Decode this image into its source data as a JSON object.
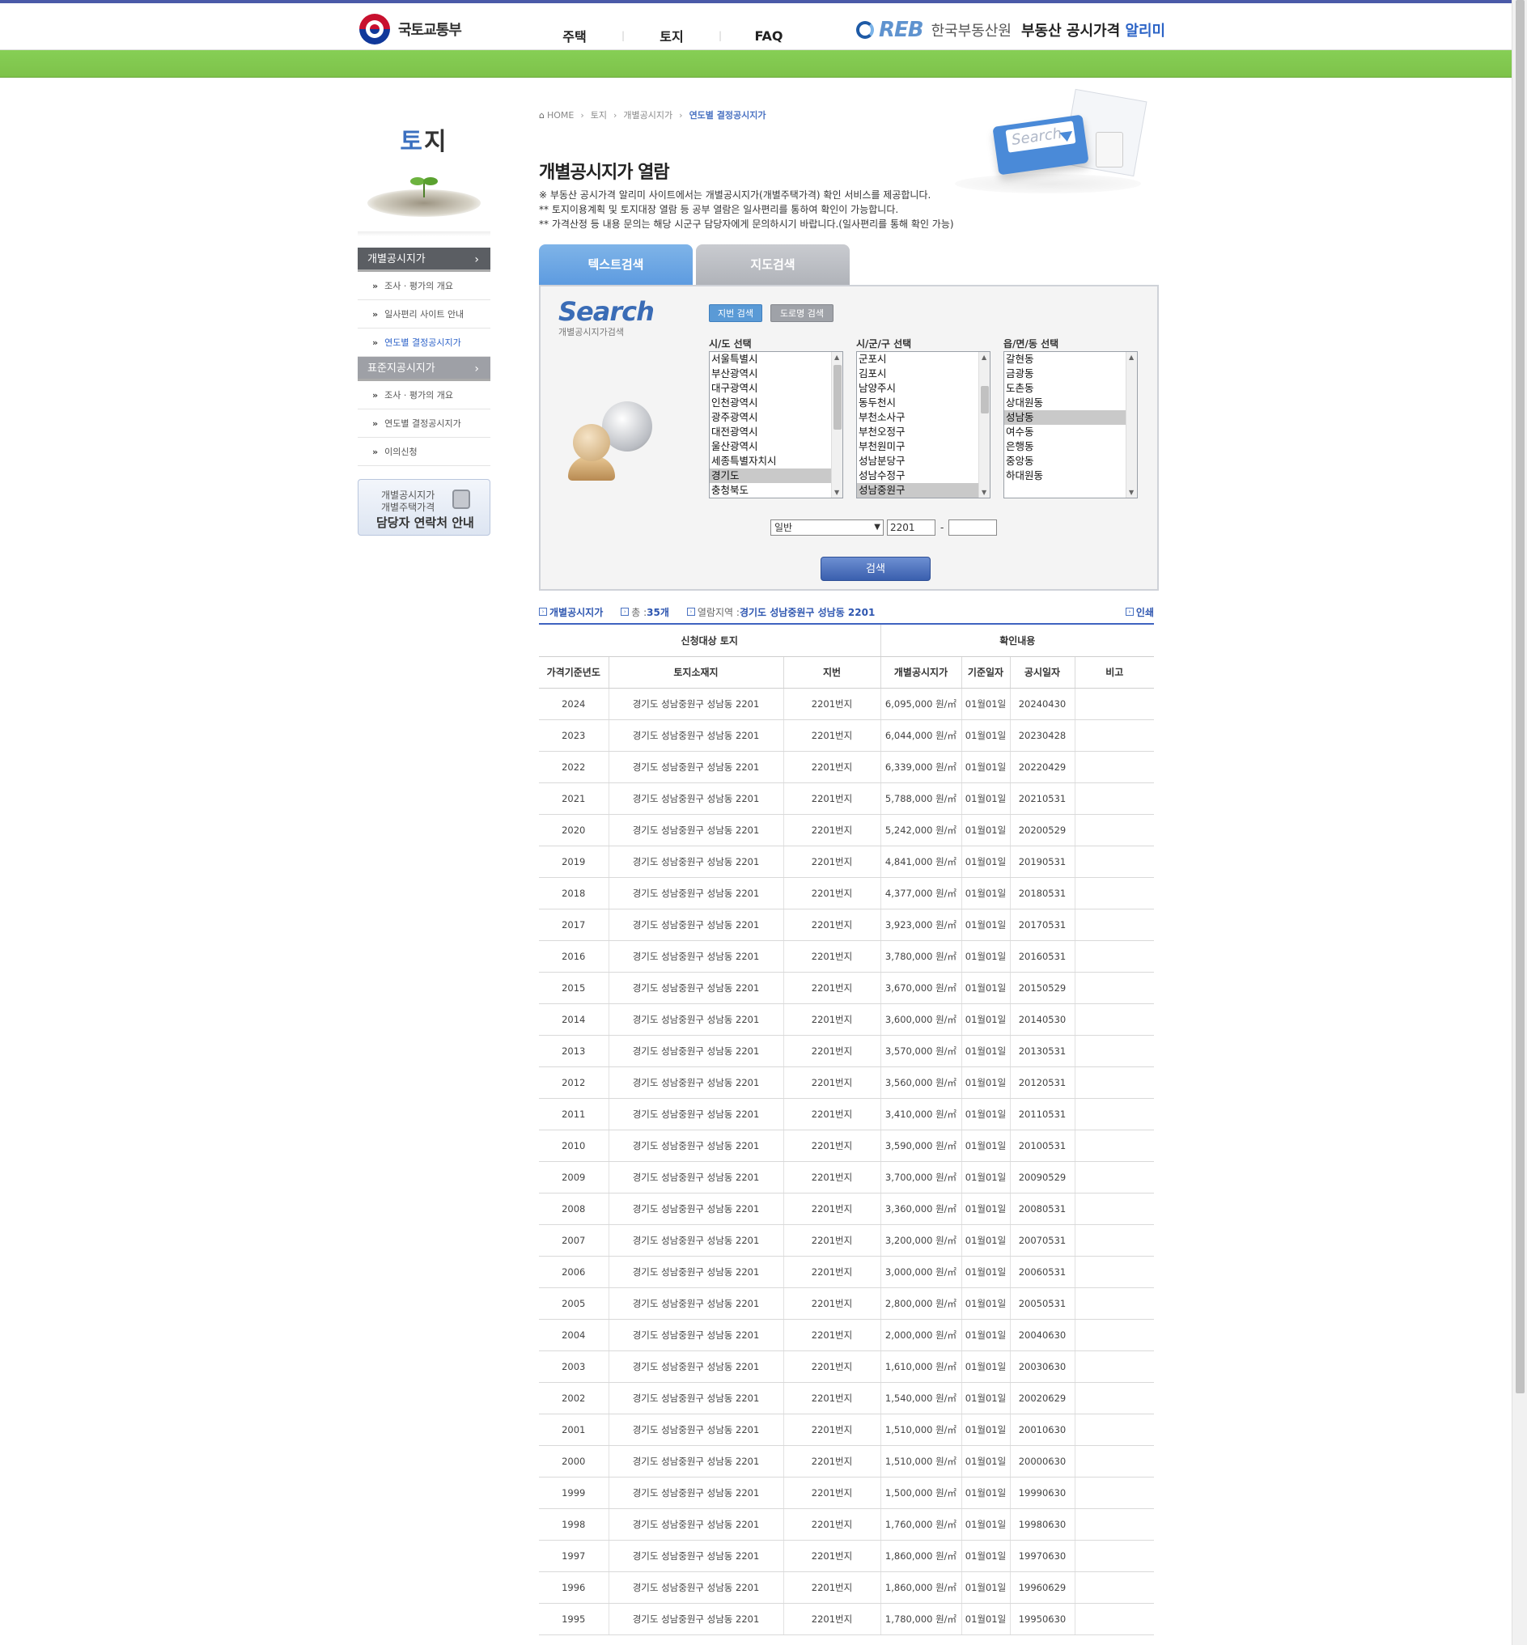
{
  "header": {
    "ministry": "국토교통부",
    "nav": [
      "주택",
      "토지",
      "FAQ"
    ],
    "reb_logo": "REB",
    "reb_kr": "한국부동산원",
    "site_title_main": "부동산 공시가격",
    "site_title_accent": "알리미"
  },
  "sidebar": {
    "title_first": "토",
    "title_rest": "지",
    "menus": [
      {
        "label": "개별공시지가",
        "subs": [
          {
            "label": "조사 · 평가의 개요",
            "active": false
          },
          {
            "label": "일사편리 사이트 안내",
            "active": false
          },
          {
            "label": "연도별 결정공시지가",
            "active": true
          }
        ]
      },
      {
        "label": "표준지공시지가",
        "subs": [
          {
            "label": "조사 · 평가의 개요",
            "active": false
          },
          {
            "label": "연도별 결정공시지가",
            "active": false
          },
          {
            "label": "이의신청",
            "active": false
          }
        ]
      }
    ],
    "banner": {
      "line1": "개별공시지가",
      "line2": "개별주택가격",
      "line3": "담당자 연락처 안내"
    }
  },
  "breadcrumb": {
    "home": "HOME",
    "items": [
      "토지",
      "개별공시지가"
    ],
    "current": "연도별 결정공시지가"
  },
  "hero_search_text": "Search",
  "page_title": "개별공시지가 열람",
  "notes": [
    "※ 부동산 공시가격 알리미 사이트에서는 개별공시지가(개별주택가격) 확인 서비스를 제공합니다.",
    "** 토지이용계획 및 토지대장 열람 등 공부 열람은 일사편리를 통하여 확인이 가능합니다.",
    "** 가격산정 등 내용 문의는 해당 시군구 담당자에게 문의하시기 바랍니다.(일사편리를 통해 확인 가능)"
  ],
  "tabs": {
    "text_search": "텍스트검색",
    "map_search": "지도검색"
  },
  "search": {
    "logo_big": "Search",
    "logo_small": "개별공시지가검색",
    "btn_lot": "지번 검색",
    "btn_road": "도로명 검색",
    "label_sido": "시/도 선택",
    "label_sigungu": "시/군/구 선택",
    "label_dong": "읍/면/동 선택",
    "sido": [
      "서울특별시",
      "부산광역시",
      "대구광역시",
      "인천광역시",
      "광주광역시",
      "대전광역시",
      "울산광역시",
      "세종특별자치시",
      "경기도",
      "충청북도"
    ],
    "sido_selected": 8,
    "sigungu": [
      "군포시",
      "김포시",
      "남양주시",
      "동두천시",
      "부천소사구",
      "부천오정구",
      "부천원미구",
      "성남분당구",
      "성남수정구",
      "성남중원구"
    ],
    "sigungu_selected": 9,
    "dong": [
      "갈현동",
      "금광동",
      "도촌동",
      "상대원동",
      "성남동",
      "여수동",
      "은행동",
      "중앙동",
      "하대원동"
    ],
    "dong_selected": 4,
    "land_type": "일반",
    "main_no": "2201",
    "dash": "-",
    "sub_no": "",
    "search_button": "검색"
  },
  "result": {
    "label": "개별공시지가",
    "total_label": "총 : ",
    "total_value": "35개",
    "region_label": "열람지역 : ",
    "region_value": "경기도 성남중원구 성남동 2201",
    "print": "인쇄"
  },
  "table": {
    "group_left": "신청대상 토지",
    "group_right": "확인내용",
    "columns": [
      "가격기준년도",
      "토지소재지",
      "지번",
      "개별공시지가",
      "기준일자",
      "공시일자",
      "비고"
    ],
    "rows": [
      [
        "2024",
        "경기도 성남중원구 성남동 2201",
        "2201번지",
        "6,095,000 원/㎡",
        "01월01일",
        "20240430",
        ""
      ],
      [
        "2023",
        "경기도 성남중원구 성남동 2201",
        "2201번지",
        "6,044,000 원/㎡",
        "01월01일",
        "20230428",
        ""
      ],
      [
        "2022",
        "경기도 성남중원구 성남동 2201",
        "2201번지",
        "6,339,000 원/㎡",
        "01월01일",
        "20220429",
        ""
      ],
      [
        "2021",
        "경기도 성남중원구 성남동 2201",
        "2201번지",
        "5,788,000 원/㎡",
        "01월01일",
        "20210531",
        ""
      ],
      [
        "2020",
        "경기도 성남중원구 성남동 2201",
        "2201번지",
        "5,242,000 원/㎡",
        "01월01일",
        "20200529",
        ""
      ],
      [
        "2019",
        "경기도 성남중원구 성남동 2201",
        "2201번지",
        "4,841,000 원/㎡",
        "01월01일",
        "20190531",
        ""
      ],
      [
        "2018",
        "경기도 성남중원구 성남동 2201",
        "2201번지",
        "4,377,000 원/㎡",
        "01월01일",
        "20180531",
        ""
      ],
      [
        "2017",
        "경기도 성남중원구 성남동 2201",
        "2201번지",
        "3,923,000 원/㎡",
        "01월01일",
        "20170531",
        ""
      ],
      [
        "2016",
        "경기도 성남중원구 성남동 2201",
        "2201번지",
        "3,780,000 원/㎡",
        "01월01일",
        "20160531",
        ""
      ],
      [
        "2015",
        "경기도 성남중원구 성남동 2201",
        "2201번지",
        "3,670,000 원/㎡",
        "01월01일",
        "20150529",
        ""
      ],
      [
        "2014",
        "경기도 성남중원구 성남동 2201",
        "2201번지",
        "3,600,000 원/㎡",
        "01월01일",
        "20140530",
        ""
      ],
      [
        "2013",
        "경기도 성남중원구 성남동 2201",
        "2201번지",
        "3,570,000 원/㎡",
        "01월01일",
        "20130531",
        ""
      ],
      [
        "2012",
        "경기도 성남중원구 성남동 2201",
        "2201번지",
        "3,560,000 원/㎡",
        "01월01일",
        "20120531",
        ""
      ],
      [
        "2011",
        "경기도 성남중원구 성남동 2201",
        "2201번지",
        "3,410,000 원/㎡",
        "01월01일",
        "20110531",
        ""
      ],
      [
        "2010",
        "경기도 성남중원구 성남동 2201",
        "2201번지",
        "3,590,000 원/㎡",
        "01월01일",
        "20100531",
        ""
      ],
      [
        "2009",
        "경기도 성남중원구 성남동 2201",
        "2201번지",
        "3,700,000 원/㎡",
        "01월01일",
        "20090529",
        ""
      ],
      [
        "2008",
        "경기도 성남중원구 성남동 2201",
        "2201번지",
        "3,360,000 원/㎡",
        "01월01일",
        "20080531",
        ""
      ],
      [
        "2007",
        "경기도 성남중원구 성남동 2201",
        "2201번지",
        "3,200,000 원/㎡",
        "01월01일",
        "20070531",
        ""
      ],
      [
        "2006",
        "경기도 성남중원구 성남동 2201",
        "2201번지",
        "3,000,000 원/㎡",
        "01월01일",
        "20060531",
        ""
      ],
      [
        "2005",
        "경기도 성남중원구 성남동 2201",
        "2201번지",
        "2,800,000 원/㎡",
        "01월01일",
        "20050531",
        ""
      ],
      [
        "2004",
        "경기도 성남중원구 성남동 2201",
        "2201번지",
        "2,000,000 원/㎡",
        "01월01일",
        "20040630",
        ""
      ],
      [
        "2003",
        "경기도 성남중원구 성남동 2201",
        "2201번지",
        "1,610,000 원/㎡",
        "01월01일",
        "20030630",
        ""
      ],
      [
        "2002",
        "경기도 성남중원구 성남동 2201",
        "2201번지",
        "1,540,000 원/㎡",
        "01월01일",
        "20020629",
        ""
      ],
      [
        "2001",
        "경기도 성남중원구 성남동 2201",
        "2201번지",
        "1,510,000 원/㎡",
        "01월01일",
        "20010630",
        ""
      ],
      [
        "2000",
        "경기도 성남중원구 성남동 2201",
        "2201번지",
        "1,510,000 원/㎡",
        "01월01일",
        "20000630",
        ""
      ],
      [
        "1999",
        "경기도 성남중원구 성남동 2201",
        "2201번지",
        "1,500,000 원/㎡",
        "01월01일",
        "19990630",
        ""
      ],
      [
        "1998",
        "경기도 성남중원구 성남동 2201",
        "2201번지",
        "1,760,000 원/㎡",
        "01월01일",
        "19980630",
        ""
      ],
      [
        "1997",
        "경기도 성남중원구 성남동 2201",
        "2201번지",
        "1,860,000 원/㎡",
        "01월01일",
        "19970630",
        ""
      ],
      [
        "1996",
        "경기도 성남중원구 성남동 2201",
        "2201번지",
        "1,860,000 원/㎡",
        "01월01일",
        "19960629",
        ""
      ],
      [
        "1995",
        "경기도 성남중원구 성남동 2201",
        "2201번지",
        "1,780,000 원/㎡",
        "01월01일",
        "19950630",
        ""
      ]
    ]
  },
  "colors": {
    "brand_blue": "#3f63c0",
    "green_band": "#7ec24a",
    "tab_active": "#5d9be0",
    "tab_inactive": "#b0b3b9"
  }
}
